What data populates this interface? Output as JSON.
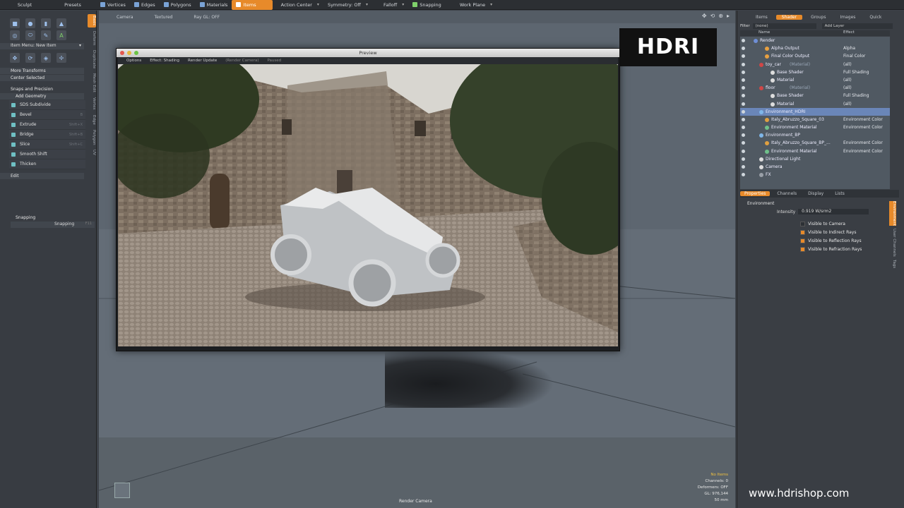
{
  "topbar": {
    "left_tabs": [
      "Sculpt",
      "Presets"
    ],
    "items": [
      {
        "label": "Vertices",
        "active": false
      },
      {
        "label": "Edges",
        "active": false
      },
      {
        "label": "Polygons",
        "active": false
      },
      {
        "label": "Materials",
        "active": false
      },
      {
        "label": "Items",
        "active": true
      }
    ],
    "dropdowns": [
      "Action Center",
      "Symmetry: Off",
      "Falloff",
      "Snapping",
      "Work Plane"
    ]
  },
  "left_panel": {
    "item_menu": "Item Menu: New Item",
    "more_transforms": "More Transforms",
    "center_selected": "Center Selected",
    "snaps_section": "Snaps and Precision",
    "add_geometry": "Add Geometry",
    "tools": [
      {
        "label": "SDS Subdivide",
        "shortcut": ""
      },
      {
        "label": "Bevel",
        "shortcut": "B"
      },
      {
        "label": "Extrude",
        "shortcut": "Shift+X"
      },
      {
        "label": "Bridge",
        "shortcut": "Shift+B"
      },
      {
        "label": "Slice",
        "shortcut": "Shift+C"
      },
      {
        "label": "Smooth Shift",
        "shortcut": ""
      },
      {
        "label": "Thicken",
        "shortcut": ""
      }
    ],
    "edit": "Edit",
    "snapping_header": "Snapping",
    "snapping_item": "Snapping",
    "snapping_shortcut": "F11",
    "vertical_tabs": [
      "Basic",
      "Deform",
      "Duplicate",
      "Mesh Edit",
      "Vertex",
      "Edge",
      "Polygon",
      "UV"
    ]
  },
  "viewport": {
    "header": [
      "Camera",
      "Textured",
      "Ray GL: OFF"
    ],
    "info": {
      "mode": "No Items",
      "channels": "Channels: 0",
      "deformers": "Deformers: OFF",
      "gl": "GL: 976,144",
      "focal": "50 mm"
    },
    "bottom_label": "Render Camera"
  },
  "preview": {
    "title": "Preview",
    "toolbar": [
      "Options",
      "Effect: Shading",
      "Render Update",
      "(Render Camera)",
      "Paused"
    ]
  },
  "logo": {
    "text": "HDRI"
  },
  "right_panel": {
    "tabs": [
      {
        "label": "Items",
        "active": false
      },
      {
        "label": "Shader",
        "active": true
      },
      {
        "label": "Groups",
        "active": false
      },
      {
        "label": "Images",
        "active": false
      },
      {
        "label": "Quick",
        "active": false
      }
    ],
    "filter_label": "Filter",
    "filter_value": "(none)",
    "add_layer": "Add Layer",
    "col_name": "Name",
    "col_effect": "Effect",
    "tree": [
      {
        "name": "Render",
        "effect": "",
        "indent": 28,
        "color": "#6f8fd6",
        "selected": false,
        "sub": ""
      },
      {
        "name": "Alpha Output",
        "effect": "Alpha",
        "indent": 44,
        "color": "#e8a040",
        "selected": false,
        "sub": ""
      },
      {
        "name": "Final Color Output",
        "effect": "Final Color",
        "indent": 44,
        "color": "#e8a040",
        "selected": false,
        "sub": ""
      },
      {
        "name": "toy_car",
        "effect": "(all)",
        "indent": 36,
        "color": "#d04646",
        "selected": false,
        "sub": "(Material)"
      },
      {
        "name": "Base Shader",
        "effect": "Full Shading",
        "indent": 52,
        "color": "#dddddd",
        "selected": false,
        "sub": ""
      },
      {
        "name": "Material",
        "effect": "(all)",
        "indent": 52,
        "color": "#dddddd",
        "selected": false,
        "sub": ""
      },
      {
        "name": "floor",
        "effect": "(all)",
        "indent": 36,
        "color": "#d04646",
        "selected": false,
        "sub": "(Material)"
      },
      {
        "name": "Base Shader",
        "effect": "Full Shading",
        "indent": 52,
        "color": "#dddddd",
        "selected": false,
        "sub": ""
      },
      {
        "name": "Material",
        "effect": "(all)",
        "indent": 52,
        "color": "#dddddd",
        "selected": false,
        "sub": ""
      },
      {
        "name": "Environment_HDRI",
        "effect": "",
        "indent": 36,
        "color": "#7fb6e8",
        "selected": true,
        "sub": ""
      },
      {
        "name": "Italy_Abruzzo_Square_03",
        "effect": "Environment Color",
        "indent": 44,
        "color": "#e0a040",
        "selected": false,
        "sub": ""
      },
      {
        "name": "Environment Material",
        "effect": "Environment Color",
        "indent": 44,
        "color": "#6fc08a",
        "selected": false,
        "sub": ""
      },
      {
        "name": "Environment_BP",
        "effect": "",
        "indent": 36,
        "color": "#7fb6e8",
        "selected": false,
        "sub": ""
      },
      {
        "name": "Italy_Abruzzo_Square_BP_...",
        "effect": "Environment Color",
        "indent": 44,
        "color": "#e0a040",
        "selected": false,
        "sub": ""
      },
      {
        "name": "Environment Material",
        "effect": "Environment Color",
        "indent": 44,
        "color": "#6fc08a",
        "selected": false,
        "sub": ""
      },
      {
        "name": "Directional Light",
        "effect": "",
        "indent": 36,
        "color": "#dddddd",
        "selected": false,
        "sub": ""
      },
      {
        "name": "Camera",
        "effect": "",
        "indent": 36,
        "color": "#dddddd",
        "selected": false,
        "sub": ""
      },
      {
        "name": "FX",
        "effect": "",
        "indent": 36,
        "color": "#9aa0a8",
        "selected": false,
        "sub": ""
      }
    ],
    "prop_tabs": [
      {
        "label": "Properties",
        "active": true
      },
      {
        "label": "Channels",
        "active": false
      },
      {
        "label": "Display",
        "active": false
      },
      {
        "label": "Lists",
        "active": false
      }
    ],
    "env_section": "Environment",
    "intensity_label": "Intensity",
    "intensity_value": "0.919 W/srm2",
    "checkboxes": [
      {
        "label": "Visible to Camera",
        "checked": false
      },
      {
        "label": "Visible to Indirect Rays",
        "checked": true
      },
      {
        "label": "Visible to Reflection Rays",
        "checked": true
      },
      {
        "label": "Visible to Refraction Rays",
        "checked": true
      }
    ],
    "vertical_tabs": [
      "Environment",
      "User Channels",
      "Tags"
    ]
  },
  "watermark": "www.hdrishop.com"
}
